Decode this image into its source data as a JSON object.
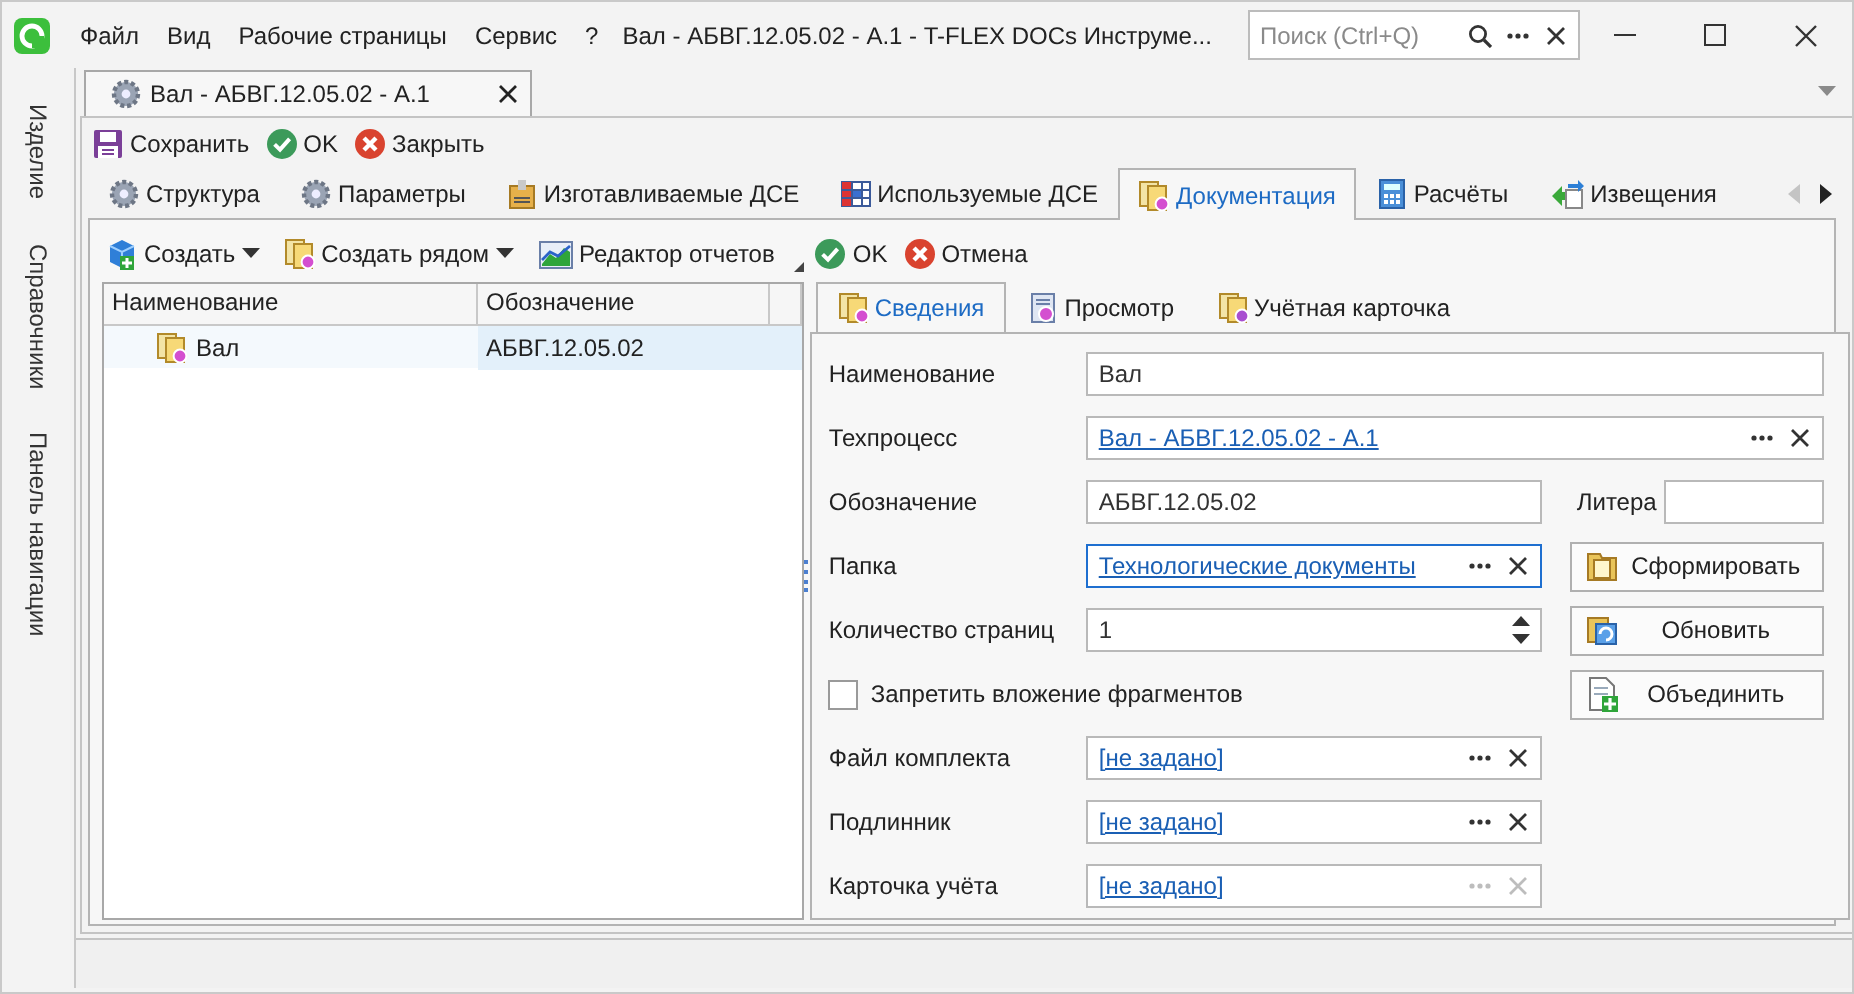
{
  "app": {
    "menu": [
      "Файл",
      "Вид",
      "Рабочие страницы",
      "Сервис",
      "?"
    ],
    "title": "Вал - АБВГ.12.05.02 - А.1 - T-FLEX DOCs Инструме...",
    "search": {
      "placeholder": "Поиск (Ctrl+Q)"
    }
  },
  "sidebar": {
    "items": [
      {
        "label": "Изделие"
      },
      {
        "label": "Справочники"
      },
      {
        "label": "Панель навигации"
      }
    ]
  },
  "document_tab": {
    "title": "Вал - АБВГ.12.05.02 - А.1"
  },
  "toolbar": [
    {
      "kind": "save",
      "label": "Сохранить"
    },
    {
      "kind": "ok",
      "label": "OK"
    },
    {
      "kind": "close",
      "label": "Закрыть"
    }
  ],
  "tabs": [
    {
      "kind": "gear",
      "label": "Структура",
      "selected": false
    },
    {
      "kind": "gear",
      "label": "Параметры",
      "selected": false
    },
    {
      "kind": "box",
      "label": "Изготавливаемые ДСЕ",
      "selected": false
    },
    {
      "kind": "table",
      "label": "Используемые ДСЕ",
      "selected": false
    },
    {
      "kind": "docs",
      "label": "Документация",
      "selected": true
    },
    {
      "kind": "calc",
      "label": "Расчёты",
      "selected": false
    },
    {
      "kind": "arrows",
      "label": "Извещения",
      "selected": false
    }
  ],
  "tree": {
    "toolbar": [
      {
        "kind": "create",
        "label": "Создать",
        "dropdown": true
      },
      {
        "kind": "create_near",
        "label": "Создать рядом",
        "dropdown": true
      },
      {
        "kind": "report",
        "label": "Редактор отчетов",
        "dropdown": false
      }
    ],
    "columns": [
      "Наименование",
      "Обозначение"
    ],
    "rows": [
      {
        "name": "Вал",
        "designation": "АБВГ.12.05.02",
        "selected": true
      }
    ]
  },
  "card": {
    "actions": [
      {
        "kind": "ok",
        "label": "OK"
      },
      {
        "kind": "cancel",
        "label": "Отмена"
      }
    ],
    "tabs": [
      {
        "kind": "docs",
        "label": "Сведения",
        "selected": true
      },
      {
        "kind": "preview",
        "label": "Просмотр",
        "selected": false
      },
      {
        "kind": "card",
        "label": "Учётная карточка",
        "selected": false
      }
    ],
    "fields": [
      {
        "kind": "text",
        "label": "Наименование",
        "value": "Вал"
      },
      {
        "kind": "link",
        "label": "Техпроцесс",
        "value": "Вал - АБВГ.12.05.02 - А.1",
        "focused": false,
        "disabled": false
      },
      {
        "kind": "text",
        "label": "Обозначение",
        "value": "АБВГ.12.05.02"
      },
      {
        "kind": "link",
        "label": "Папка",
        "value": "Технологические документы",
        "focused": true,
        "disabled": false
      },
      {
        "kind": "spin",
        "label": "Количество страниц",
        "value": "1"
      },
      {
        "kind": "checkbox",
        "label": "Запретить вложение фрагментов",
        "checked": false
      },
      {
        "kind": "link",
        "label": "Файл комплекта",
        "value": "[не задано]",
        "focused": false,
        "disabled": false
      },
      {
        "kind": "link",
        "label": "Подлинник",
        "value": "[не задано]",
        "focused": false,
        "disabled": false
      },
      {
        "kind": "link",
        "label": "Карточка учёта",
        "value": "[не задано]",
        "focused": false,
        "disabled": true
      }
    ],
    "side": [
      {
        "kind": "field",
        "label": "Литера"
      },
      {
        "kind": "form",
        "label": "Сформировать"
      },
      {
        "kind": "refresh",
        "label": "Обновить"
      },
      {
        "kind": "merge",
        "label": "Объединить"
      }
    ]
  }
}
